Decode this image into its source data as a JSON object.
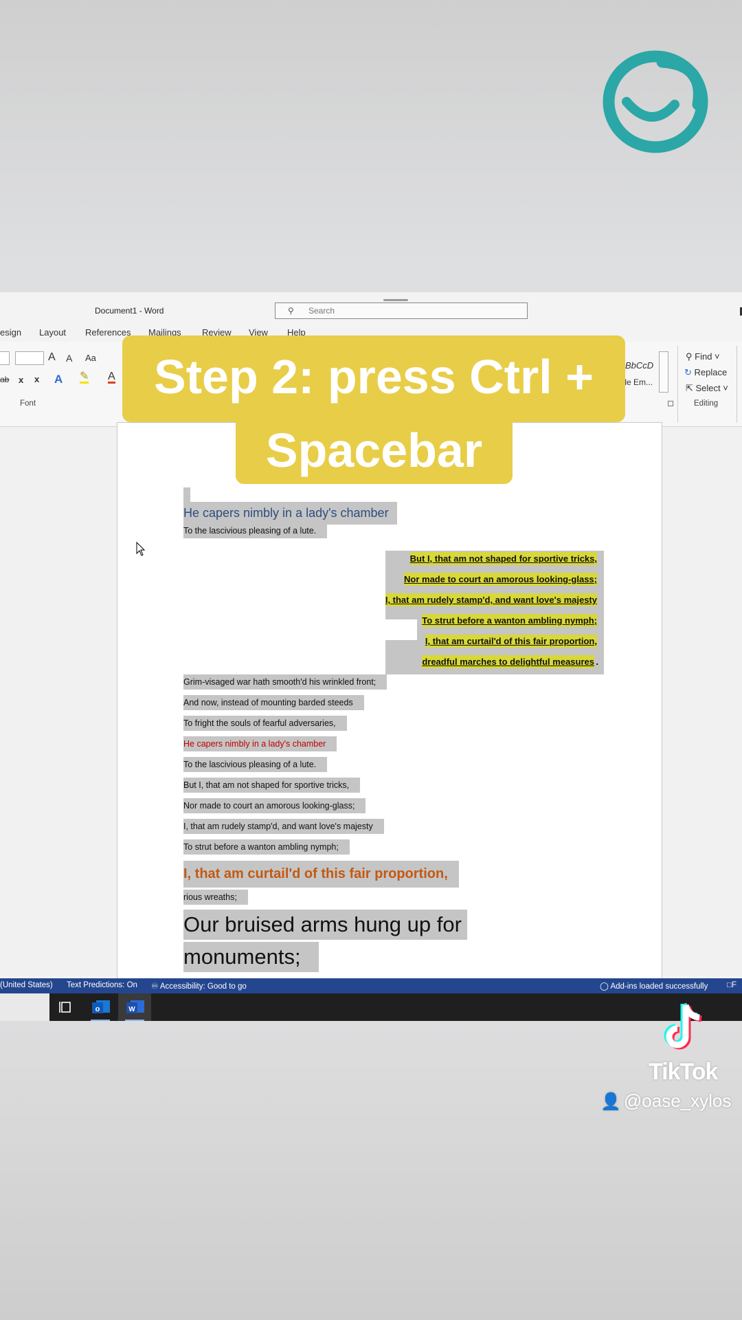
{
  "window": {
    "title": "Document1  -  Word"
  },
  "search": {
    "placeholder": "Search"
  },
  "ribbon_tabs": [
    "esign",
    "Layout",
    "References",
    "Mailings",
    "Review",
    "View",
    "Help"
  ],
  "ribbon": {
    "font_group_label": "Font",
    "editing_group_label": "Editing",
    "find_label": "Find",
    "replace_label": "Replace",
    "select_label": "Select",
    "style_preview_1": "BbCcD",
    "style_preview_2": "tle Em...",
    "grow_font": "A",
    "shrink_font": "A",
    "change_case": "Aa",
    "strikethrough": "ab",
    "subscript": "x",
    "superscript": "x",
    "text_effects": "A",
    "font_color": "A"
  },
  "caption": {
    "line1": "Step 2: press Ctrl +",
    "line2": "Spacebar"
  },
  "document": {
    "blue_heading": "He capers nimbly in a lady's chamber",
    "line_lute_1": "To the lascivious pleasing of a lute.",
    "highlighted": [
      "But I, that am not shaped for sportive tricks,",
      "Nor made to court an amorous looking-glass;",
      "I, that am rudely stamp'd, and want love's majesty",
      "To strut before a wanton ambling nymph;",
      "I, that am curtail'd of this fair proportion,",
      "dreadful marches to delightful measures"
    ],
    "period": ".",
    "plain": [
      "Grim-visaged war hath smooth'd his wrinkled front;",
      "And now, instead of mounting barded steeds",
      "To fright the souls of fearful adversaries,",
      "He capers nimbly in a lady's chamber",
      "To the lascivious pleasing of a lute.",
      "But I, that am not shaped for sportive tricks,",
      "Nor made to court an amorous looking-glass;",
      "I, that am rudely stamp'd, and want love's majesty",
      "To strut before a wanton ambling nymph;"
    ],
    "orange_line": "I, that am curtail'd of this fair proportion,",
    "wreaths": "rious wreaths;",
    "big_line_1": "Our bruised arms hung up for",
    "big_line_2": "monuments;"
  },
  "status_bar": {
    "language": "(United States)",
    "predictions": "Text Predictions: On",
    "accessibility": "Accessibility: Good to go",
    "addins": "Add-ins loaded successfully",
    "edge": "F"
  },
  "watermark": {
    "brand": "TikTok",
    "user": "@oase_xylos"
  },
  "colors": {
    "accent_yellow": "#e8cd48",
    "logo_teal": "#2aa7a6",
    "status_blue": "#24468e",
    "highlight": "#d8d839"
  }
}
